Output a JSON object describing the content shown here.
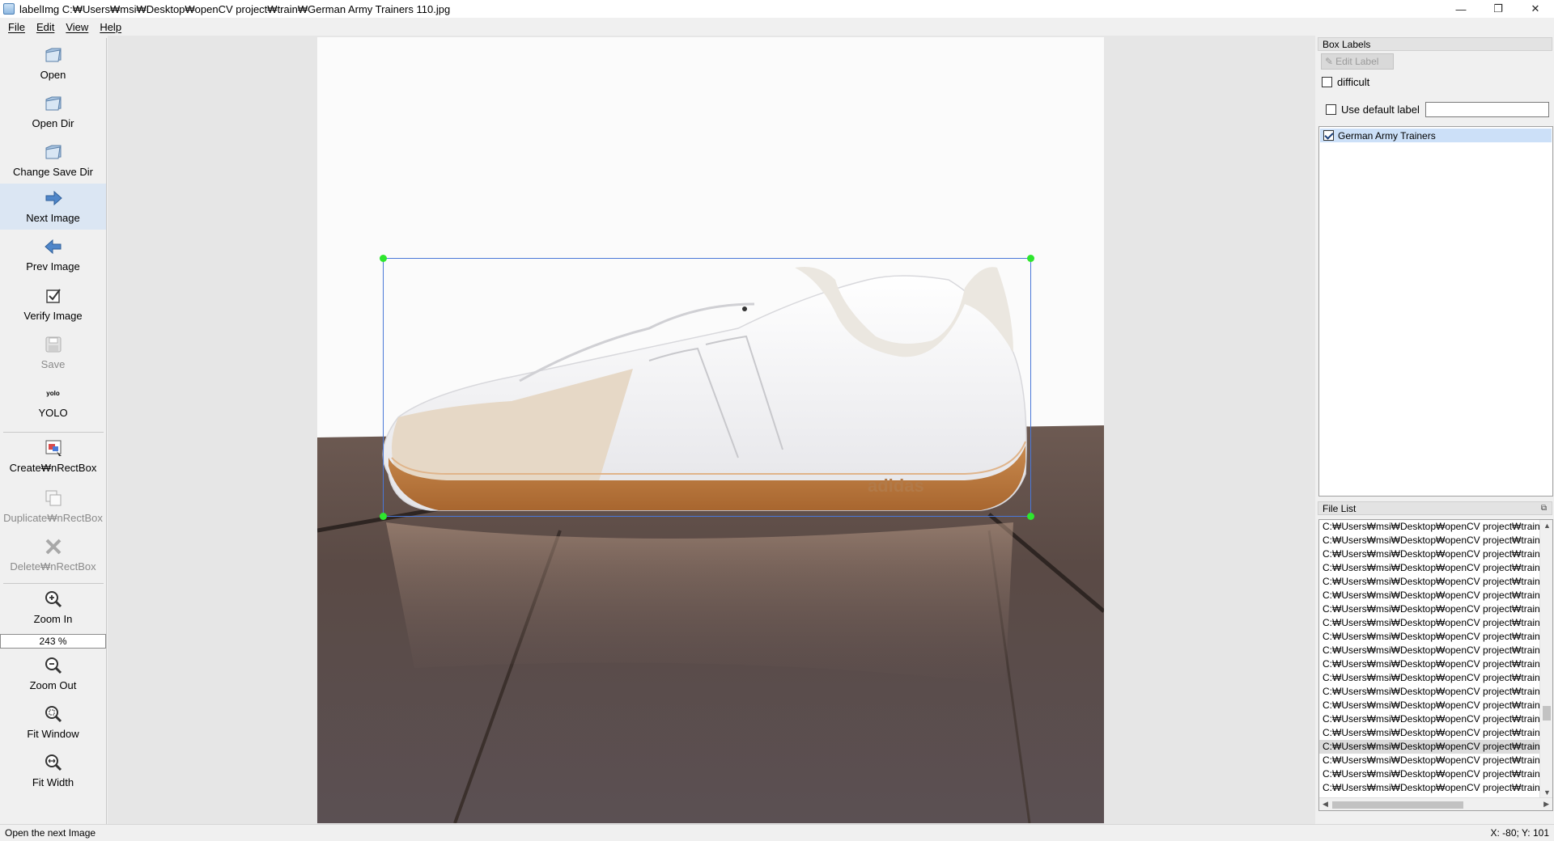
{
  "window": {
    "title": "labelImg C:₩Users₩msi₩Desktop₩openCV project₩train₩German Army Trainers 110.jpg",
    "controls": {
      "minimize": "—",
      "restore": "❐",
      "close": "✕"
    }
  },
  "menu": {
    "items": [
      "File",
      "Edit",
      "View",
      "Help"
    ]
  },
  "toolbar": {
    "open": "Open",
    "open_dir": "Open Dir",
    "change_save_dir": "Change Save Dir",
    "next_image": "Next Image",
    "prev_image": "Prev Image",
    "verify_image": "Verify Image",
    "save": "Save",
    "yolo": "YOLO",
    "yolo_icon_text": "yolo",
    "create_rectbox": "Create₩nRectBox",
    "duplicate_rectbox": "Duplicate₩nRectBox",
    "delete_rectbox": "Delete₩nRectBox",
    "zoom_in": "Zoom In",
    "zoom_value": "243 %",
    "zoom_out": "Zoom Out",
    "fit_window": "Fit Window",
    "fit_width": "Fit Width"
  },
  "box_labels": {
    "title": "Box Labels",
    "edit_label": "Edit Label",
    "difficult": "difficult",
    "use_default_label": "Use default label",
    "default_label_value": "",
    "labels": [
      {
        "text": "German Army Trainers",
        "checked": true
      }
    ]
  },
  "file_list": {
    "title": "File List",
    "float_icon": "⧉",
    "items": [
      "C:₩Users₩msi₩Desktop₩openCV project₩train₩G",
      "C:₩Users₩msi₩Desktop₩openCV project₩train₩G",
      "C:₩Users₩msi₩Desktop₩openCV project₩train₩G",
      "C:₩Users₩msi₩Desktop₩openCV project₩train₩G",
      "C:₩Users₩msi₩Desktop₩openCV project₩train₩G",
      "C:₩Users₩msi₩Desktop₩openCV project₩train₩G",
      "C:₩Users₩msi₩Desktop₩openCV project₩train₩G",
      "C:₩Users₩msi₩Desktop₩openCV project₩train₩G",
      "C:₩Users₩msi₩Desktop₩openCV project₩train₩G",
      "C:₩Users₩msi₩Desktop₩openCV project₩train₩G",
      "C:₩Users₩msi₩Desktop₩openCV project₩train₩G",
      "C:₩Users₩msi₩Desktop₩openCV project₩train₩G",
      "C:₩Users₩msi₩Desktop₩openCV project₩train₩G",
      "C:₩Users₩msi₩Desktop₩openCV project₩train₩G",
      "C:₩Users₩msi₩Desktop₩openCV project₩train₩G",
      "C:₩Users₩msi₩Desktop₩openCV project₩train₩G",
      "C:₩Users₩msi₩Desktop₩openCV project₩train₩G",
      "C:₩Users₩msi₩Desktop₩openCV project₩train₩G",
      "C:₩Users₩msi₩Desktop₩openCV project₩train₩G",
      "C:₩Users₩msi₩Desktop₩openCV project₩train₩G"
    ],
    "current_index": 16
  },
  "status": {
    "message": "Open the next Image",
    "coords": "X: -80; Y: 101"
  },
  "colors": {
    "bbox": "#4a78d8",
    "handle": "#2ee62e",
    "selection": "#cce0f8",
    "active_tool": "#dbe6f3"
  }
}
